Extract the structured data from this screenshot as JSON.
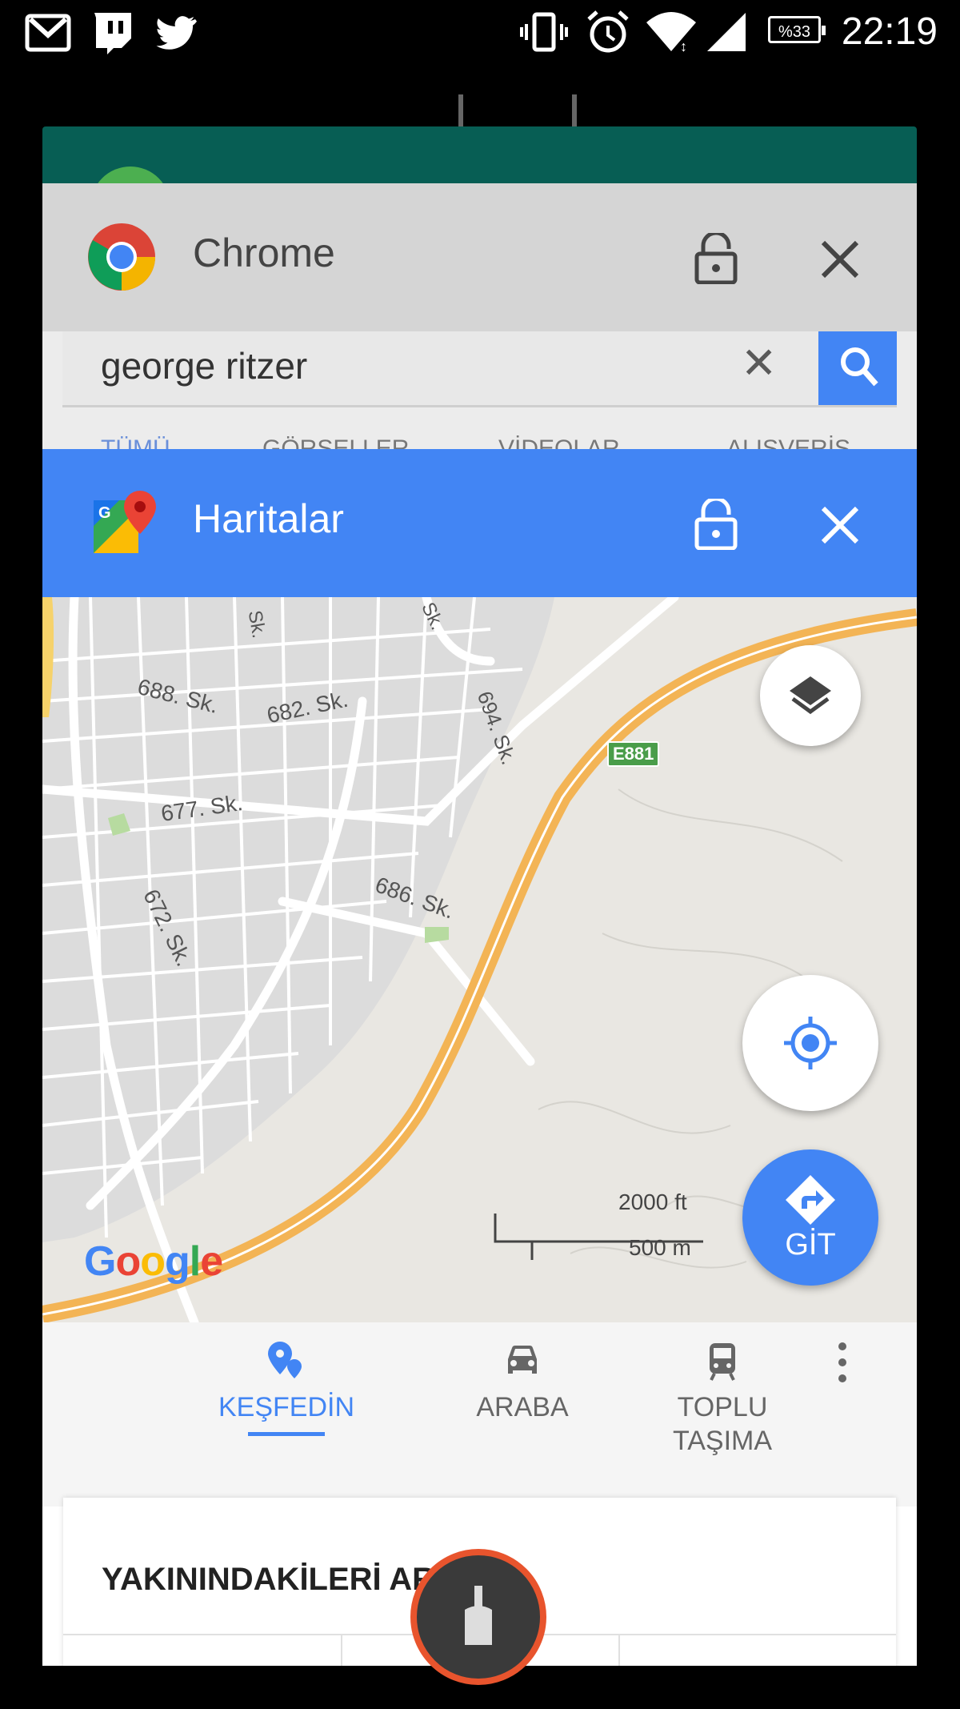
{
  "status_bar": {
    "time": "22:19",
    "battery": "%33",
    "left_icons": [
      "gmail-icon",
      "twitch-icon",
      "twitter-icon"
    ],
    "right_icons": [
      "vibrate-icon",
      "alarm-icon",
      "wifi-icon",
      "signal-icon",
      "battery-icon"
    ]
  },
  "chrome_card": {
    "title": "Chrome",
    "search_query": "george ritzer",
    "tabs": [
      "TÜMÜ",
      "GÖRSELLER",
      "VİDEOLAR",
      "ALIŞVERİŞ"
    ]
  },
  "maps_card": {
    "title": "Haritalar",
    "map": {
      "streets": [
        "Sk.",
        "Sk.",
        "688. Sk.",
        "682. Sk.",
        "694. Sk.",
        "677. Sk.",
        "686. Sk.",
        "672. Sk."
      ],
      "road_badge": "E881",
      "scale_ft": "2000 ft",
      "scale_m": "500 m",
      "google_logo": "Google"
    },
    "go_button": "GİT",
    "nav": [
      {
        "label": "KEŞFEDİN",
        "icon": "explore-pin-icon",
        "active": true
      },
      {
        "label": "ARABA",
        "icon": "car-icon",
        "active": false
      },
      {
        "label": "TOPLU\nTAŞIMA",
        "icon": "transit-icon",
        "active": false
      }
    ],
    "nearby_title": "YAKININDAKİLERİ ARA"
  },
  "colors": {
    "maps_blue": "#4285f4",
    "whatsapp_green": "#075e54",
    "highway_orange": "#f3b455",
    "clean_ring": "#e8542d"
  }
}
